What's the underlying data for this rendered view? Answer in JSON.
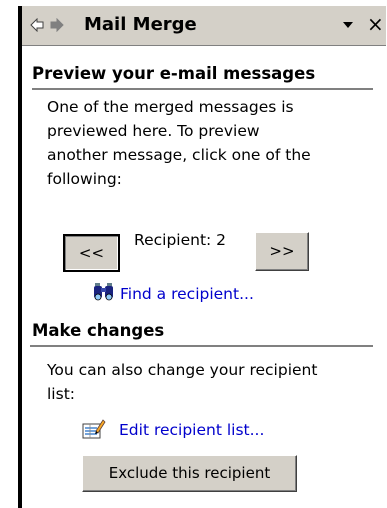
{
  "titlebar": {
    "title": "Mail Merge",
    "back_icon": "back-arrow-icon",
    "forward_icon": "forward-arrow-icon",
    "dropdown_icon": "dropdown-triangle-icon",
    "close_label": "×"
  },
  "preview": {
    "heading": "Preview your e-mail messages",
    "description_lines": [
      "One of the merged messages is",
      "previewed here. To preview",
      "another message, click one of the",
      "following:"
    ],
    "prev_button": "<<",
    "next_button": ">>",
    "recipient_label": "Recipient: 2",
    "find_link": "Find a recipient...",
    "find_icon": "binoculars-icon"
  },
  "changes": {
    "heading": "Make changes",
    "description_lines": [
      "You can also change your recipient",
      "list:"
    ],
    "edit_link": "Edit recipient list...",
    "edit_icon": "edit-list-icon",
    "exclude_button": "Exclude this recipient"
  },
  "colors": {
    "titlebar_bg": "#d4d0c8",
    "link": "#0000cc",
    "button_face": "#d4d0c8"
  }
}
